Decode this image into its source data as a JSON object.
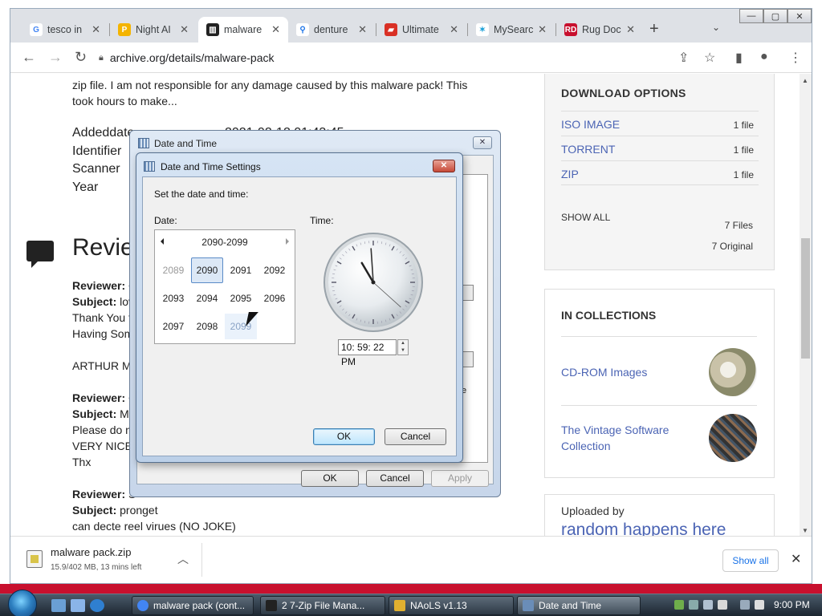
{
  "browser": {
    "tabs": [
      {
        "label": "tesco in",
        "favicon": "google-icon",
        "color": "#4285f4"
      },
      {
        "label": "Night AI",
        "favicon": "p-icon",
        "color": "#f4b400"
      },
      {
        "label": "malware",
        "favicon": "archive-icon",
        "color": "#222222",
        "active": true
      },
      {
        "label": "denture",
        "favicon": "search-icon",
        "color": "#1a73e8"
      },
      {
        "label": "Ultimate",
        "favicon": "book-icon",
        "color": "#d93025"
      },
      {
        "label": "MySearc",
        "favicon": "star-icon",
        "color": "#1aa0d8"
      },
      {
        "label": "Rug Doc",
        "favicon": "rd-icon",
        "color": "#c8102e"
      }
    ],
    "url": "archive.org/details/malware-pack"
  },
  "page": {
    "description": "zip file. I am not responsible for any damage caused by this malware pack! This took hours to make...",
    "metadata": [
      {
        "key": "Addeddate",
        "value": "2021-02-12 01:43:45"
      },
      {
        "key": "Identifier",
        "value": ""
      },
      {
        "key": "Scanner",
        "value": ""
      },
      {
        "key": "Year",
        "value": ""
      }
    ],
    "reviews_title": "Revie",
    "reviews": [
      {
        "lines": [
          {
            "label": "Reviewer:",
            "text": "C"
          },
          {
            "label": "Subject:",
            "text": "lov"
          },
          {
            "label": "",
            "text": "Thank You f"
          },
          {
            "label": "",
            "text": "Having Som"
          },
          {
            "label": "",
            "text": ""
          },
          {
            "label": "",
            "text": "ARTHUR M"
          }
        ]
      },
      {
        "lines": [
          {
            "label": "Reviewer:",
            "text": "C"
          },
          {
            "label": "Subject:",
            "text": "M"
          },
          {
            "label": "",
            "text": "Please do n"
          },
          {
            "label": "",
            "text": "VERY NICE"
          },
          {
            "label": "",
            "text": "Thx"
          }
        ]
      },
      {
        "lines": [
          {
            "label": "Reviewer:",
            "text": "S"
          },
          {
            "label": "Subject:",
            "text": "pronget"
          },
          {
            "label": "",
            "text": "can decte reel virues (NO JOKE)"
          }
        ]
      }
    ],
    "download_options": {
      "title": "DOWNLOAD OPTIONS",
      "items": [
        {
          "label": "ISO IMAGE",
          "count": "1 file"
        },
        {
          "label": "TORRENT",
          "count": "1 file"
        },
        {
          "label": "ZIP",
          "count": "1 file"
        }
      ],
      "show_all": "SHOW ALL",
      "files_total": "7 Files",
      "files_original": "7 Original"
    },
    "collections": {
      "title": "IN COLLECTIONS",
      "items": [
        {
          "label": "CD-ROM Images"
        },
        {
          "label": "The Vintage Software Collection"
        }
      ]
    },
    "uploaded_by_label": "Uploaded by",
    "uploader": "random happens here"
  },
  "outer_dialog": {
    "title": "Date and Time",
    "fragment_text": "e",
    "ok": "OK",
    "cancel": "Cancel",
    "apply": "Apply"
  },
  "dialog": {
    "title": "Date and Time Settings",
    "prompt": "Set the date and time:",
    "date_label": "Date:",
    "time_label": "Time:",
    "decade": "2090-2099",
    "years": [
      "2089",
      "2090",
      "2091",
      "2092",
      "2093",
      "2094",
      "2095",
      "2096",
      "2097",
      "2098",
      "2099"
    ],
    "selected_year": "2090",
    "time_value": "10: 59: 22 PM",
    "clock": {
      "hour": 22,
      "minute": 59,
      "second": 22
    },
    "ok": "OK",
    "cancel": "Cancel"
  },
  "downloads": {
    "file_name": "malware pack.zip",
    "status": "15.9/402 MB, 13 mins left",
    "show_all": "Show all"
  },
  "taskbar": {
    "items": [
      {
        "label": "malware pack (cont...",
        "color": "#4285f4"
      },
      {
        "label": "2 7-Zip File Mana...",
        "color": "#222222"
      },
      {
        "label": "NAoLS v1.13",
        "color": "#e0b030"
      },
      {
        "label": "Date and Time",
        "color": "#6a8db8",
        "active": true
      }
    ],
    "clock": "9:00 PM"
  }
}
